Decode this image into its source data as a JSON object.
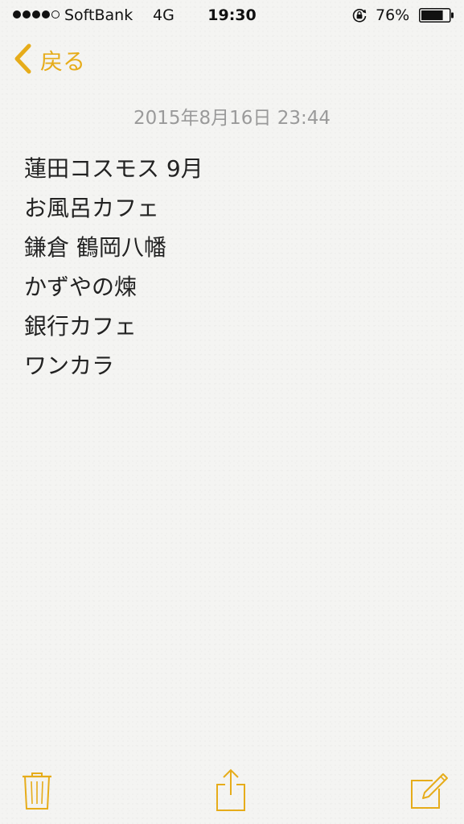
{
  "status_bar": {
    "carrier": "SoftBank",
    "network": "4G",
    "time": "19:30",
    "battery_percent": "76%",
    "battery_level": 0.76,
    "signal_bars_filled": 4,
    "signal_bars_total": 5,
    "icons": [
      "signal-dots-icon",
      "rotation-lock-icon",
      "battery-icon"
    ]
  },
  "nav": {
    "back_label": "戻る",
    "back_icon": "chevron-left-icon"
  },
  "note": {
    "date": "2015年8月16日 23:44",
    "lines": [
      "蓮田コスモス 9月",
      "お風呂カフェ",
      "鎌倉 鶴岡八幡",
      "かずやの煉",
      "銀行カフェ",
      "ワンカラ"
    ]
  },
  "toolbar": {
    "icons": [
      "trash-icon",
      "share-icon",
      "compose-icon"
    ]
  },
  "colors": {
    "accent": "#e6ac1a",
    "date_text": "#9a9a9a",
    "body_text": "#222222",
    "paper": "#f4f4f2"
  }
}
